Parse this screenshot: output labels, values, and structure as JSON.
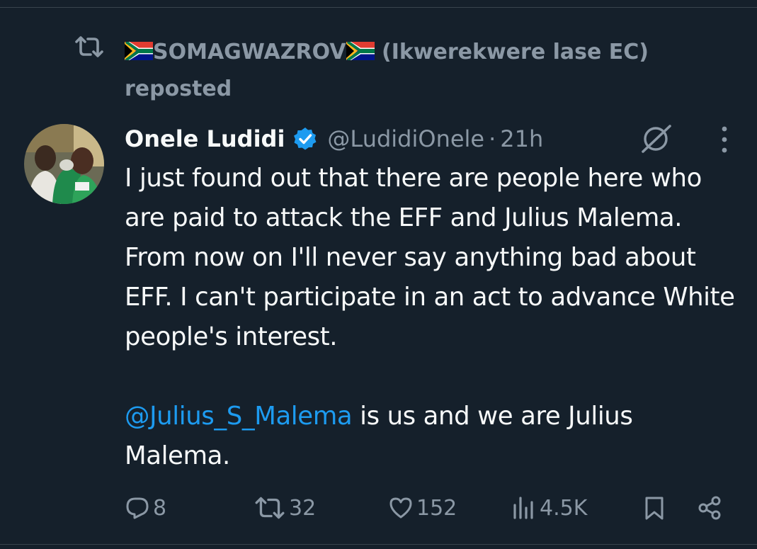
{
  "repost": {
    "reposter_name": "SOMAGWAZROV",
    "reposter_suffix": " (Ikwerekwere lase EC)",
    "reposted_label": "reposted"
  },
  "tweet": {
    "author_name": "Onele Ludidi",
    "handle": "@LudidiOnele",
    "separator": "·",
    "time": "21h",
    "paragraph1": "I just found out that there are people here who are paid to attack the EFF and Julius Malema. From now on I'll never say anything bad about EFF. I can't participate in an act to advance White people's interest.",
    "mention": "@Julius_S_Malema",
    "paragraph2_rest": " is us and we are Julius Malema."
  },
  "actions": {
    "replies": "8",
    "reposts": "32",
    "likes": "152",
    "views": "4.5K"
  },
  "icons": [
    "repost-icon",
    "flag-south-africa-icon",
    "verified-badge-icon",
    "grok-icon",
    "more-icon",
    "reply-icon",
    "like-icon",
    "views-icon",
    "bookmark-icon",
    "share-icon"
  ],
  "colors": {
    "background": "#15202b",
    "text": "#f7f9f9",
    "secondary": "#8b98a5",
    "accent": "#1d9bf0"
  }
}
